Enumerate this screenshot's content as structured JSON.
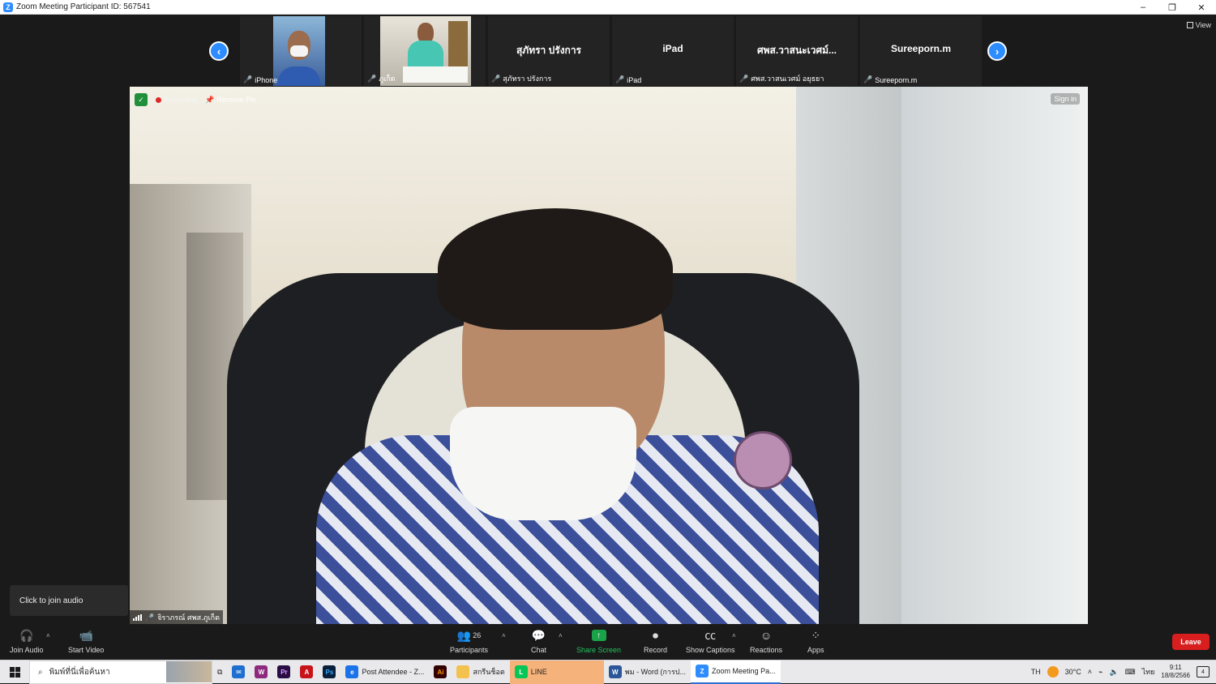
{
  "window": {
    "title": "Zoom Meeting Participant ID: 567541",
    "minimize": "–",
    "restore": "❐",
    "close": "✕"
  },
  "view_button": {
    "label": "View"
  },
  "thumbnails": [
    {
      "name": "",
      "label": "iPhone",
      "has_video": true
    },
    {
      "name": "",
      "label": "ภูเก็ต",
      "has_video": true
    },
    {
      "name": "สุภัทรา ปรังการ",
      "label": "สุภัทรา ปรังการ",
      "has_video": false
    },
    {
      "name": "iPad",
      "label": "iPad",
      "has_video": false
    },
    {
      "name": "ศพส.วาสนะเวศม์...",
      "label": "ศพส.วาสนเวศม์ อยุธยา",
      "has_video": false
    },
    {
      "name": "Sureeporn.m",
      "label": "Sureeporn.m",
      "has_video": false
    }
  ],
  "main_video": {
    "recording_label": "Recording",
    "remove_pin_label": "Remove Pin",
    "sign_in_label": "Sign in",
    "participant_name": "จิราภรณ์ ศพส.ภูเก็ต"
  },
  "tooltip": {
    "text": "Click to join audio"
  },
  "toolbar": {
    "join_audio": "Join Audio",
    "start_video": "Start Video",
    "participants": "Participants",
    "participants_count": "26",
    "chat": "Chat",
    "share_screen": "Share Screen",
    "record": "Record",
    "show_captions": "Show Captions",
    "reactions": "Reactions",
    "apps": "Apps",
    "leave": "Leave"
  },
  "taskbar": {
    "search_placeholder": "พิมพ์ที่นี่เพื่อค้นหา",
    "apps": [
      {
        "label": "Post Attendee - Z...",
        "color": "#1a73e8"
      },
      {
        "label": "สกรีนช็อต",
        "color": "#f2c14e"
      },
      {
        "label": "LINE",
        "color": "#06c755"
      },
      {
        "label": "พม - Word (การป...",
        "color": "#2b579a"
      },
      {
        "label": "Zoom Meeting Pa...",
        "color": "#2d8cff"
      }
    ],
    "language": "TH",
    "temperature": "30°C",
    "input_lang": "ไทย",
    "time": "9:11",
    "date": "18/8/2566",
    "notification_count": "4"
  },
  "colors": {
    "accent": "#2d8cff",
    "leave": "#d81e1e",
    "share": "#1ba34a",
    "recording": "#e02828"
  }
}
